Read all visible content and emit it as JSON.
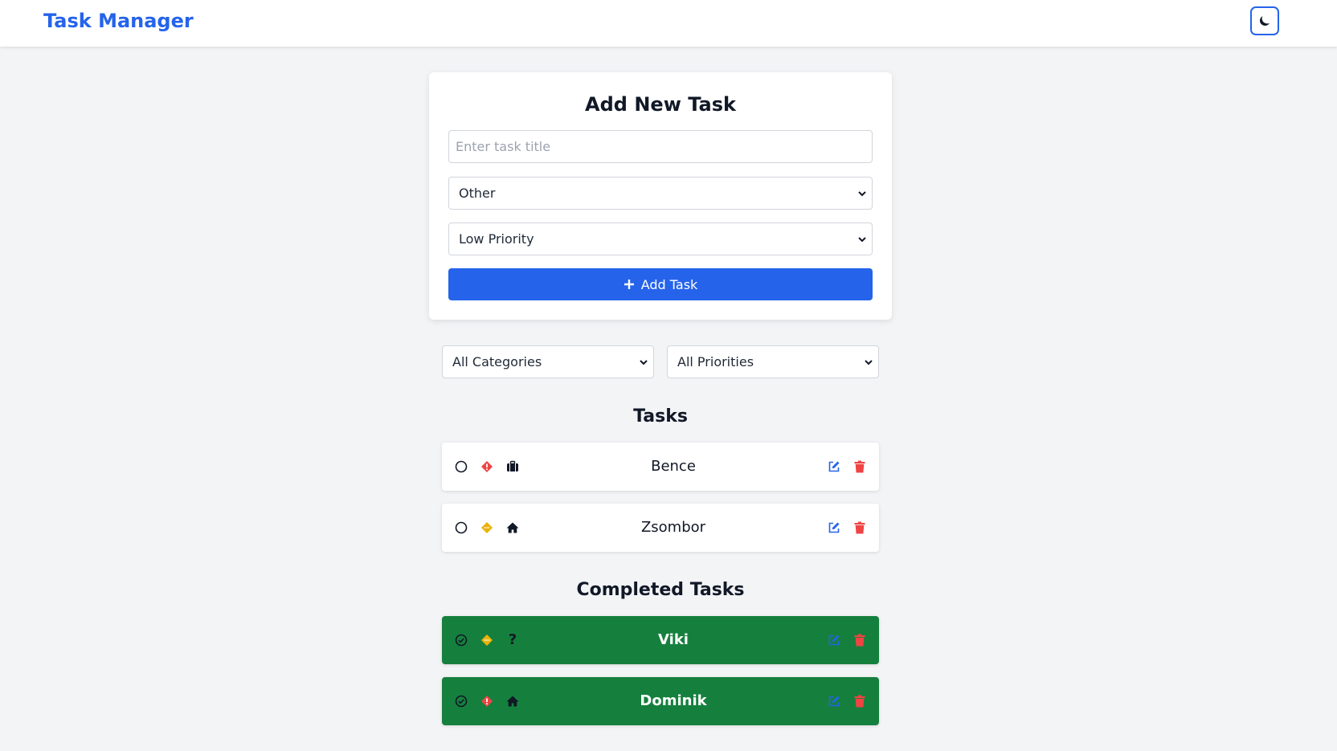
{
  "app": {
    "title": "Task Manager"
  },
  "form": {
    "heading": "Add New Task",
    "title_placeholder": "Enter task title",
    "title_value": "",
    "category_selected": "Other",
    "priority_selected": "Low Priority",
    "add_button_label": "Add Task"
  },
  "filters": {
    "category_selected": "All Categories",
    "priority_selected": "All Priorities"
  },
  "tasks_heading": "Tasks",
  "tasks": [
    {
      "title": "Bence",
      "completed": false,
      "priority": "high",
      "category": "work"
    },
    {
      "title": "Zsombor",
      "completed": false,
      "priority": "medium",
      "category": "home"
    }
  ],
  "completed_heading": "Completed Tasks",
  "completed_tasks": [
    {
      "title": "Viki",
      "completed": true,
      "priority": "medium",
      "category": "other"
    },
    {
      "title": "Dominik",
      "completed": true,
      "priority": "high",
      "category": "home"
    }
  ],
  "colors": {
    "accent": "#2563eb",
    "completed_bg": "#15803d",
    "priority_high": "#ef4444",
    "priority_medium": "#eab308",
    "delete": "#ef4444",
    "page_bg": "#f3f4f6"
  },
  "icons": {
    "theme_toggle": "moon-icon",
    "add": "plus-icon",
    "edit": "edit-icon",
    "delete": "trash-icon",
    "category_work": "briefcase-icon",
    "category_home": "home-icon",
    "category_other": "question-icon"
  }
}
